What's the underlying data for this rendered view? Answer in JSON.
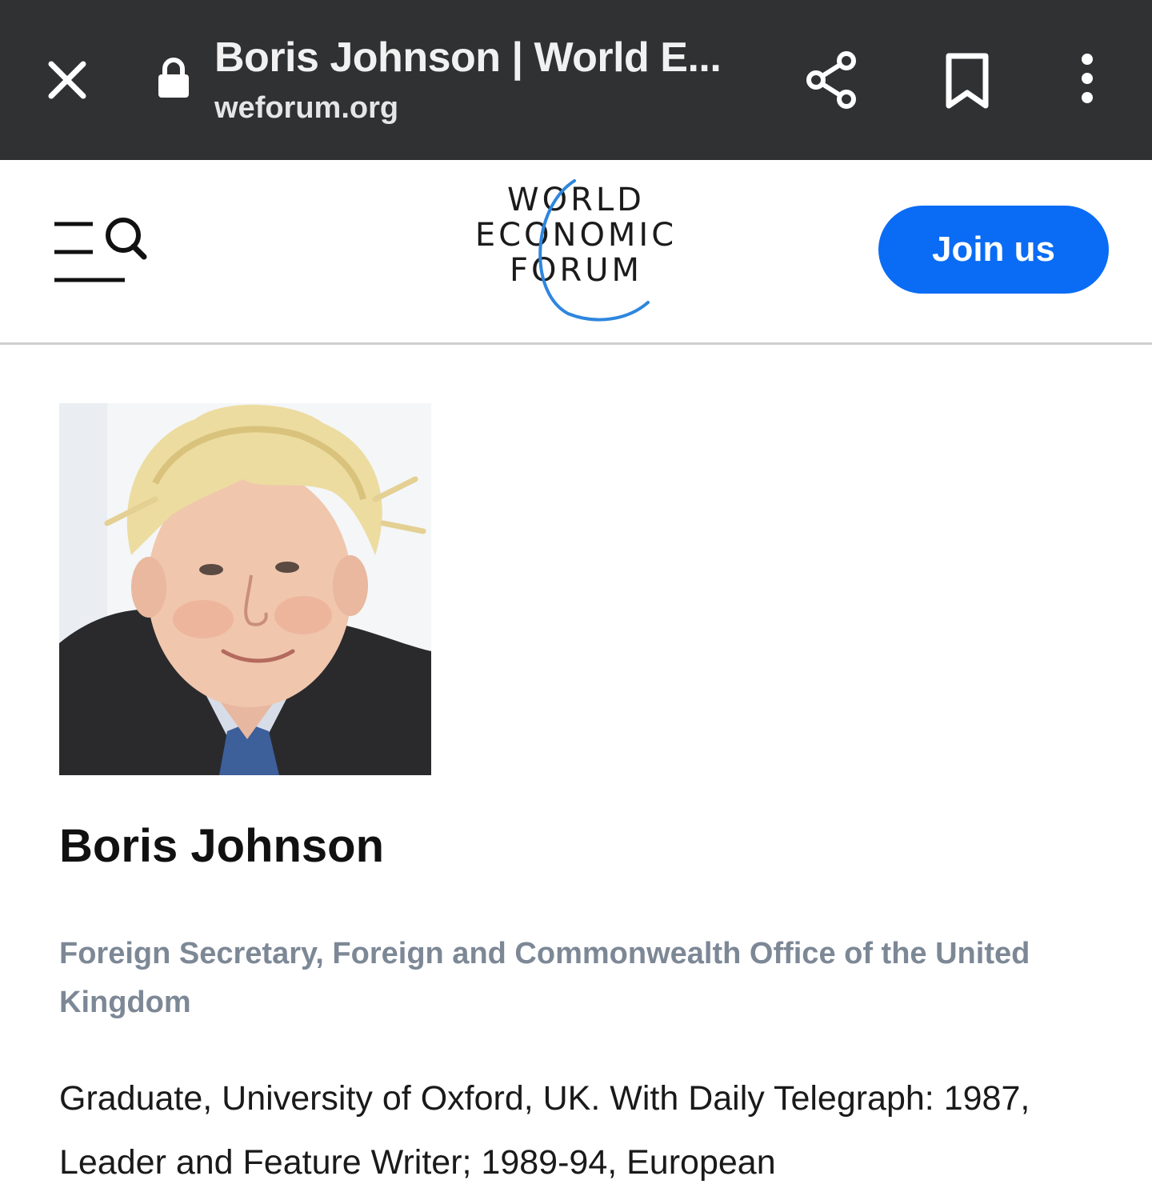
{
  "browser": {
    "page_title": "Boris Johnson | World E...",
    "url": "weforum.org"
  },
  "header": {
    "logo": {
      "line1": "WORLD",
      "line2": "ECONOMIC",
      "line3": "FORUM"
    },
    "join_label": "Join us"
  },
  "profile": {
    "name": "Boris Johnson",
    "role": "Foreign Secretary, Foreign and Commonwealth Office of the United Kingdom",
    "bio": "Graduate, University of Oxford, UK. With Daily Telegraph: 1987, Leader and Feature Writer; 1989-94, European"
  },
  "colors": {
    "browser_bar": "#2f3133",
    "brand_blue": "#0a6cf5",
    "role_text": "#7d8896"
  },
  "icons": [
    "close-icon",
    "lock-icon",
    "share-icon",
    "bookmark-icon",
    "more-vert-icon",
    "menu-search-icon"
  ]
}
